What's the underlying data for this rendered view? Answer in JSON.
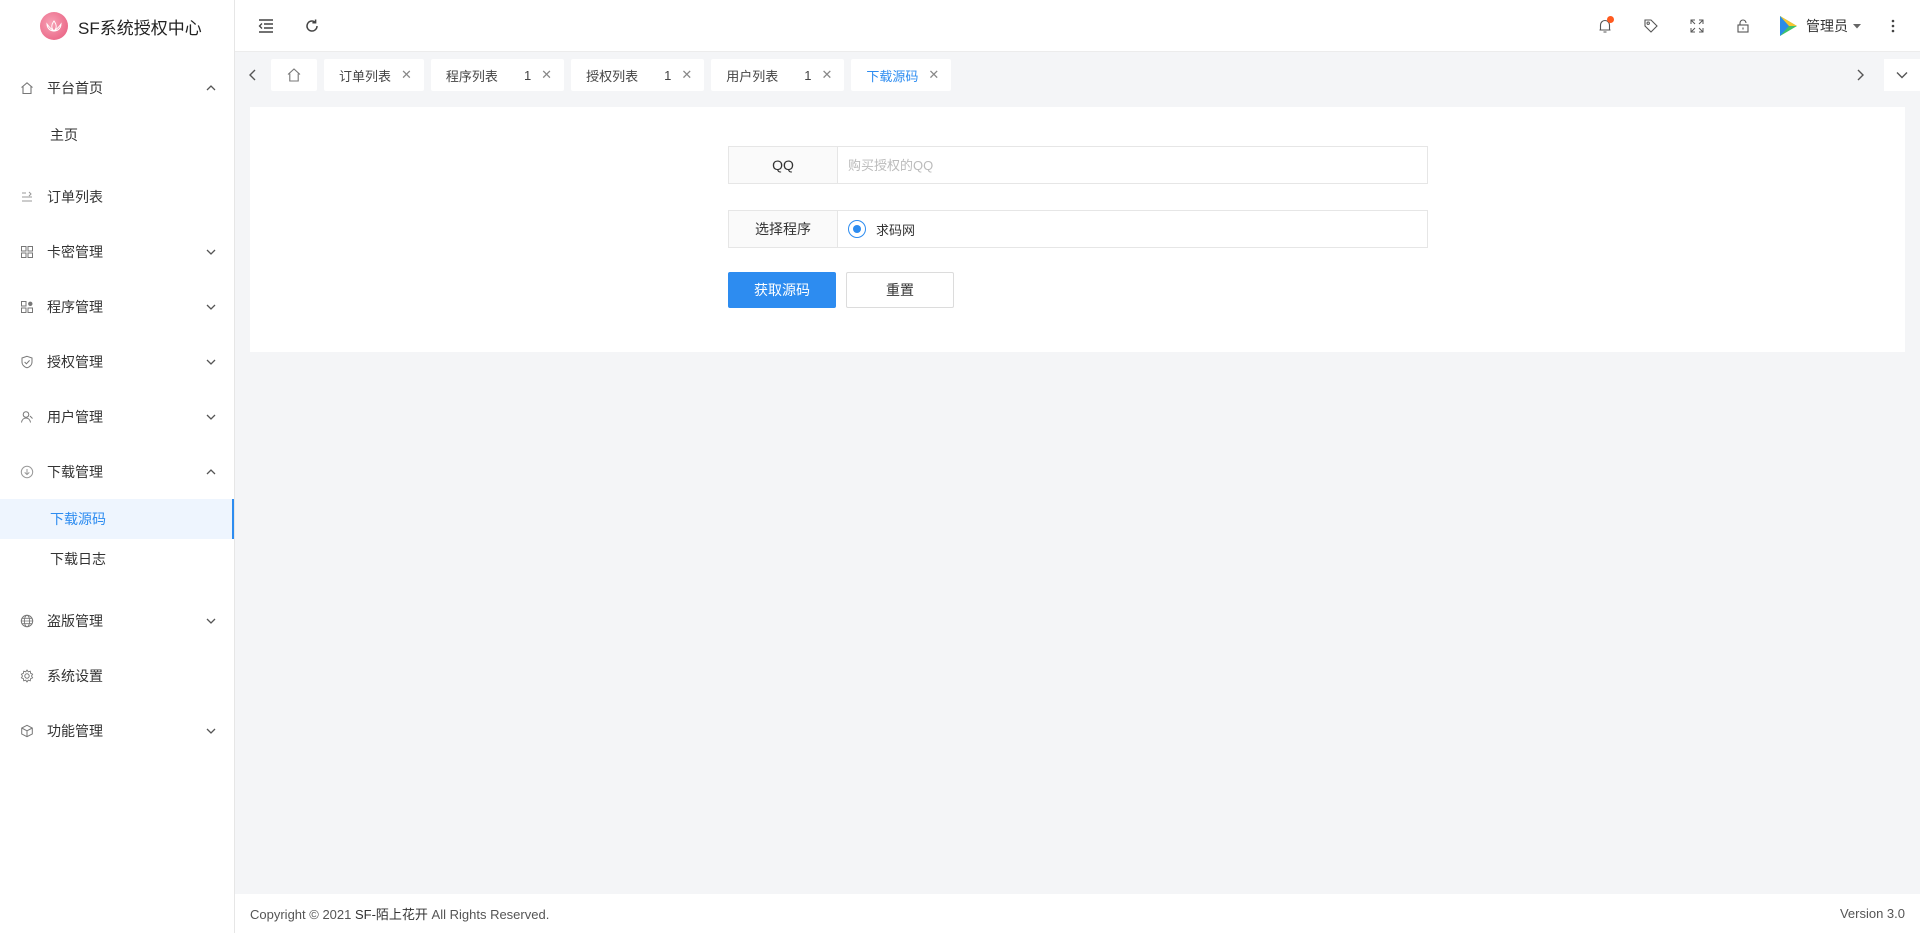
{
  "app": {
    "title": "SF系统授权中心"
  },
  "sidebar": {
    "items": [
      {
        "label": "平台首页",
        "icon": "home-icon",
        "expanded": true,
        "children": [
          {
            "label": "主页"
          }
        ]
      },
      {
        "label": "订单列表",
        "icon": "list-icon"
      },
      {
        "label": "卡密管理",
        "icon": "grid-icon",
        "expanded": false
      },
      {
        "label": "程序管理",
        "icon": "apps-icon",
        "expanded": false
      },
      {
        "label": "授权管理",
        "icon": "shield-check-icon",
        "expanded": false
      },
      {
        "label": "用户管理",
        "icon": "user-icon",
        "expanded": false
      },
      {
        "label": "下载管理",
        "icon": "download-icon",
        "expanded": true,
        "children": [
          {
            "label": "下载源码",
            "active": true
          },
          {
            "label": "下载日志"
          }
        ]
      },
      {
        "label": "盗版管理",
        "icon": "globe-icon",
        "expanded": false
      },
      {
        "label": "系统设置",
        "icon": "gear-icon"
      },
      {
        "label": "功能管理",
        "icon": "cube-icon",
        "expanded": false
      }
    ]
  },
  "header": {
    "user_name": "管理员"
  },
  "tabs": [
    {
      "label": "订单列表"
    },
    {
      "label": "程序列表",
      "count": "1"
    },
    {
      "label": "授权列表",
      "count": "1"
    },
    {
      "label": "用户列表",
      "count": "1"
    },
    {
      "label": "下载源码",
      "active": true
    }
  ],
  "form": {
    "qq_label": "QQ",
    "qq_placeholder": "购买授权的QQ",
    "program_label": "选择程序",
    "program_option": "求码网",
    "submit_label": "获取源码",
    "reset_label": "重置"
  },
  "footer": {
    "copyright_prefix": "Copyright © 2021 ",
    "brand": "SF-陌上花开",
    "copyright_suffix": " All Rights Reserved.",
    "version": "Version 3.0"
  },
  "colors": {
    "accent": "#2d8cf0",
    "notification_dot": "#ff5a1f"
  }
}
